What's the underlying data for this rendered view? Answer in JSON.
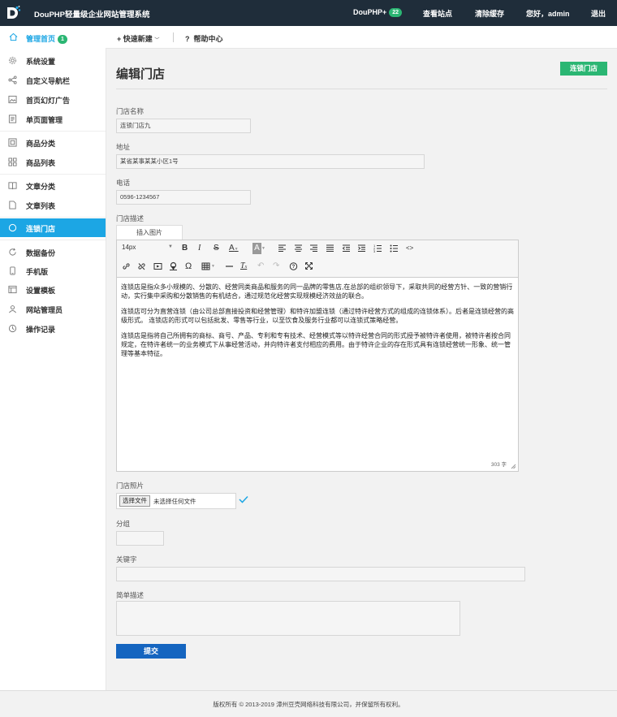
{
  "header": {
    "system_title": "DouPHP轻量级企业网站管理系统",
    "douphp_label": "DouPHP+",
    "douphp_badge": "22",
    "view_site": "查看站点",
    "clear_cache": "清除缓存",
    "greeting": "您好，admin",
    "logout": "退出"
  },
  "subbar": {
    "home": "管理首页",
    "home_badge": "1",
    "quick_new": "快速新建",
    "help": "帮助中心"
  },
  "sidebar": {
    "items": [
      {
        "label": "系统设置",
        "icon": "gear-icon"
      },
      {
        "label": "自定义导航栏",
        "icon": "share-icon"
      },
      {
        "label": "首页幻灯广告",
        "icon": "image-icon"
      },
      {
        "label": "单页面管理",
        "icon": "page-icon"
      },
      {
        "label": "商品分类",
        "icon": "grid-icon"
      },
      {
        "label": "商品列表",
        "icon": "tiles-icon"
      },
      {
        "label": "文章分类",
        "icon": "book-icon"
      },
      {
        "label": "文章列表",
        "icon": "file-icon"
      },
      {
        "label": "连锁门店",
        "icon": "circle-icon"
      },
      {
        "label": "数据备份",
        "icon": "refresh-icon"
      },
      {
        "label": "手机版",
        "icon": "mobile-icon"
      },
      {
        "label": "设置模板",
        "icon": "template-icon"
      },
      {
        "label": "网站管理员",
        "icon": "user-icon"
      },
      {
        "label": "操作记录",
        "icon": "clock-icon"
      }
    ]
  },
  "page": {
    "title": "编辑门店",
    "chain_button": "连锁门店",
    "name_label": "门店名称",
    "name_value": "连锁门店九",
    "address_label": "地址",
    "address_value": "某省某事某某小区1号",
    "phone_label": "电话",
    "phone_value": "0596-1234567",
    "desc_label": "门店描述",
    "insert_image": "插入图片",
    "font_size": "14px",
    "content": [
      "连锁店是指众多小规模的、分散的、经营同类商品和服务的同一品牌的零售店,在总部的组织领导下，采取共同的经营方针、一致的营销行动，实行集中采购和分散销售的有机结合，通过规范化经营实现规模经济效益的联合。",
      "连锁店可分为直营连锁（由公司总部直接投资和经营管理）和特许加盟连锁（通过特许经营方式的组成的连锁体系）。后者是连锁经营的高级形式。 连锁店的形式可以包括批发、零售等行业，以至饮食及服务行业都可以连锁式策略经营。",
      "连锁店是指将自己所拥有的商标、商号、产品、专利和专有技术、经营模式等以特许经营合同的形式授予被特许者使用，被特许者按合同规定，在特许者统一的业务模式下从事经营活动，并向特许者支付相应的费用。由于特许企业的存在形式具有连锁经营统一形象、统一管理等基本特征。"
    ],
    "word_count": "303 字",
    "photo_label": "门店照片",
    "file_button": "选择文件",
    "file_text": "未选择任何文件",
    "group_label": "分组",
    "group_value": "",
    "keyword_label": "关键字",
    "keyword_value": "",
    "brief_label": "简单描述",
    "brief_value": "",
    "submit": "提交"
  },
  "footer": {
    "copyright": "版权所有 © 2013-2019 漳州豆壳网络科技有限公司，并保留所有权利。"
  },
  "colors": {
    "topbar": "#1f2d3a",
    "accent": "#1ca6e4",
    "green": "#2bb673",
    "submit": "#1565c0"
  }
}
